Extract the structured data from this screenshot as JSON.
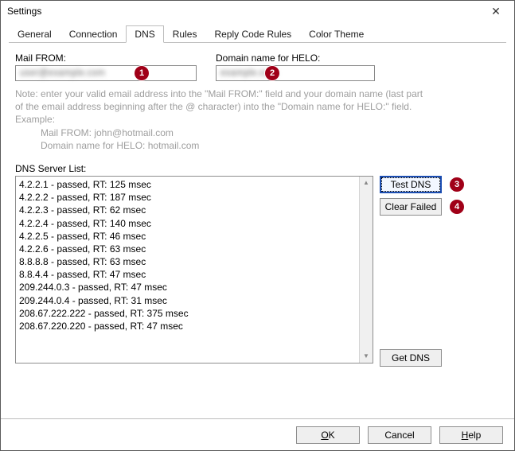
{
  "window": {
    "title": "Settings"
  },
  "tabs": [
    {
      "label": "General",
      "active": false
    },
    {
      "label": "Connection",
      "active": false
    },
    {
      "label": "DNS",
      "active": true
    },
    {
      "label": "Rules",
      "active": false
    },
    {
      "label": "Reply Code Rules",
      "active": false
    },
    {
      "label": "Color Theme",
      "active": false
    }
  ],
  "fields": {
    "mail_from": {
      "label": "Mail FROM:",
      "value": ""
    },
    "helo": {
      "label": "Domain name for HELO:",
      "value": ""
    }
  },
  "note": {
    "line1": "Note: enter your valid email address into the \"Mail FROM:\" field and your domain name (last part",
    "line2": "of the email address beginning after the @ character) into the \"Domain name for HELO:\" field.",
    "line3": "Example:",
    "line4": "Mail FROM: john@hotmail.com",
    "line5": "Domain name for HELO: hotmail.com"
  },
  "dns_list": {
    "label": "DNS Server List:",
    "items": [
      "4.2.2.1 - passed, RT: 125 msec",
      "4.2.2.2 - passed, RT: 187 msec",
      "4.2.2.3 - passed, RT: 62 msec",
      "4.2.2.4 - passed, RT: 140 msec",
      "4.2.2.5 - passed, RT: 46 msec",
      "4.2.2.6 - passed, RT: 63 msec",
      "8.8.8.8 - passed, RT: 63 msec",
      "8.8.4.4 - passed, RT: 47 msec",
      "209.244.0.3 - passed, RT: 47 msec",
      "209.244.0.4 - passed, RT: 31 msec",
      "208.67.222.222 - passed, RT: 375 msec",
      "208.67.220.220 - passed, RT: 47 msec"
    ]
  },
  "buttons": {
    "test_dns": "Test DNS",
    "clear_failed": "Clear Failed",
    "get_dns": "Get DNS",
    "ok": "OK",
    "cancel": "Cancel",
    "help": "Help"
  },
  "annotations": {
    "1": "1",
    "2": "2",
    "3": "3",
    "4": "4"
  }
}
